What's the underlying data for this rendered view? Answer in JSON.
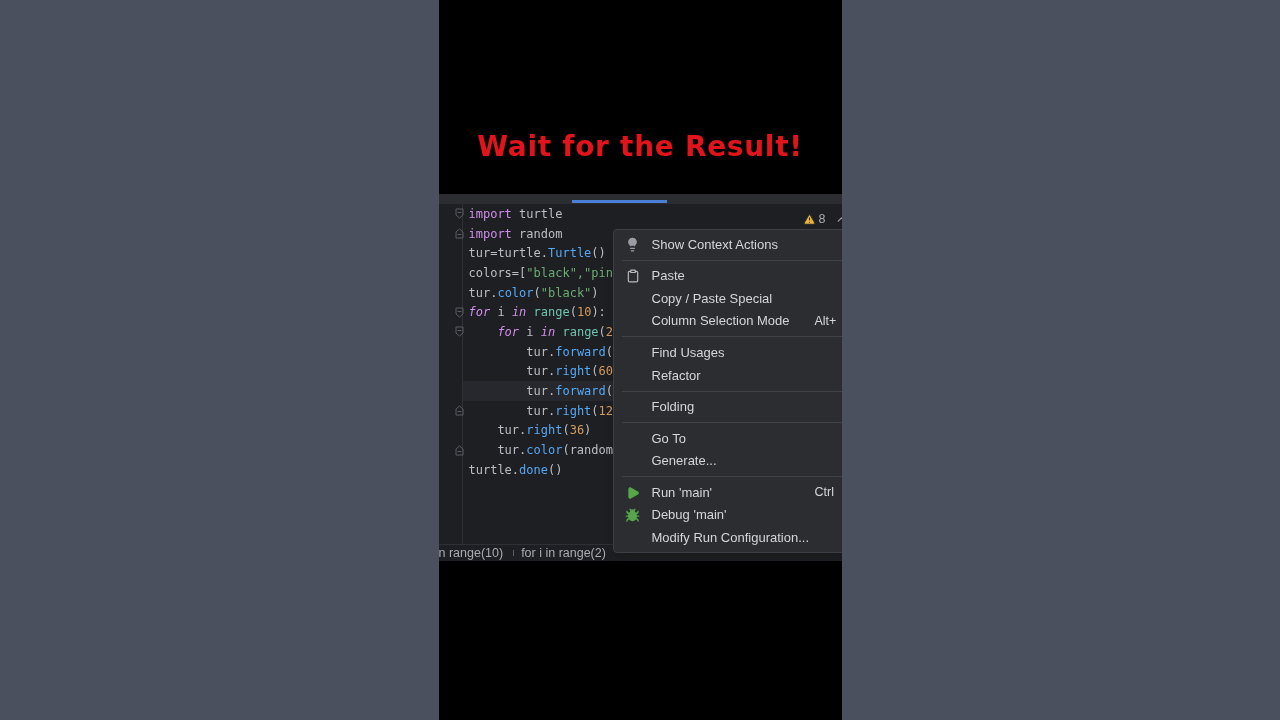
{
  "banner": {
    "title": "Wait for the Result!"
  },
  "editor": {
    "inspection": {
      "count": "8"
    },
    "lines": [
      {
        "kind": "fold-start",
        "current": false,
        "tokens": [
          {
            "kind": "keyword",
            "text": "import"
          },
          {
            "kind": "plain",
            "text": " turtle"
          }
        ]
      },
      {
        "kind": "fold-end",
        "current": false,
        "tokens": [
          {
            "kind": "keyword",
            "text": "import"
          },
          {
            "kind": "plain",
            "text": " random"
          }
        ]
      },
      {
        "current": false,
        "tokens": [
          {
            "kind": "plain",
            "text": "tur=turtle."
          },
          {
            "kind": "func",
            "text": "Turtle"
          },
          {
            "kind": "plain",
            "text": "()"
          }
        ]
      },
      {
        "current": false,
        "tokens": [
          {
            "kind": "plain",
            "text": "colors=["
          },
          {
            "kind": "string",
            "text": "\"black\",\"pin"
          }
        ]
      },
      {
        "current": false,
        "tokens": [
          {
            "kind": "plain",
            "text": "tur."
          },
          {
            "kind": "func",
            "text": "color"
          },
          {
            "kind": "plain",
            "text": "("
          },
          {
            "kind": "string",
            "text": "\"black\""
          },
          {
            "kind": "plain",
            "text": ")"
          }
        ]
      },
      {
        "kind": "fold-start",
        "current": false,
        "tokens": [
          {
            "kind": "italic",
            "text": "for"
          },
          {
            "kind": "plain",
            "text": " i "
          },
          {
            "kind": "italic",
            "text": "in "
          },
          {
            "kind": "builtin",
            "text": "range"
          },
          {
            "kind": "plain",
            "text": "("
          },
          {
            "kind": "number",
            "text": "10"
          },
          {
            "kind": "plain",
            "text": "):"
          }
        ]
      },
      {
        "kind": "fold-start",
        "current": false,
        "tokens": [
          {
            "kind": "italic",
            "text": "    for"
          },
          {
            "kind": "plain",
            "text": " i "
          },
          {
            "kind": "italic",
            "text": "in "
          },
          {
            "kind": "builtin",
            "text": "range"
          },
          {
            "kind": "plain",
            "text": "("
          },
          {
            "kind": "number",
            "text": "2"
          }
        ]
      },
      {
        "current": false,
        "tokens": [
          {
            "kind": "plain",
            "text": "        tur."
          },
          {
            "kind": "func",
            "text": "forward"
          },
          {
            "kind": "plain",
            "text": "("
          }
        ]
      },
      {
        "current": false,
        "tokens": [
          {
            "kind": "plain",
            "text": "        tur."
          },
          {
            "kind": "func",
            "text": "right"
          },
          {
            "kind": "plain",
            "text": "("
          },
          {
            "kind": "number",
            "text": "60"
          }
        ]
      },
      {
        "current": true,
        "tokens": [
          {
            "kind": "plain",
            "text": "        tur."
          },
          {
            "kind": "func",
            "text": "forward"
          },
          {
            "kind": "plain",
            "text": "("
          }
        ]
      },
      {
        "kind": "fold-end",
        "current": false,
        "tokens": [
          {
            "kind": "plain",
            "text": "        tur."
          },
          {
            "kind": "func",
            "text": "right"
          },
          {
            "kind": "plain",
            "text": "("
          },
          {
            "kind": "number",
            "text": "12"
          }
        ]
      },
      {
        "current": false,
        "tokens": [
          {
            "kind": "plain",
            "text": "    tur."
          },
          {
            "kind": "func",
            "text": "right"
          },
          {
            "kind": "plain",
            "text": "("
          },
          {
            "kind": "number",
            "text": "36"
          },
          {
            "kind": "plain",
            "text": ")"
          }
        ]
      },
      {
        "kind": "fold-end",
        "current": false,
        "tokens": [
          {
            "kind": "plain",
            "text": "    tur."
          },
          {
            "kind": "func",
            "text": "color"
          },
          {
            "kind": "plain",
            "text": "(random"
          }
        ]
      },
      {
        "current": false,
        "tokens": [
          {
            "kind": "plain",
            "text": "turtle."
          },
          {
            "kind": "func",
            "text": "done"
          },
          {
            "kind": "plain",
            "text": "()"
          }
        ]
      }
    ],
    "breadcrumbs": [
      "n range(10)",
      "for i in range(2)"
    ]
  },
  "context_menu": {
    "groups": [
      [
        {
          "kind": "bulb",
          "label": "Show Context Actions"
        }
      ],
      [
        {
          "kind": "paste",
          "label": "Paste"
        },
        {
          "kind": "plain",
          "label": "Copy / Paste Special"
        },
        {
          "kind": "plain",
          "label": "Column Selection Mode",
          "shortcut": "Alt+"
        }
      ],
      [
        {
          "kind": "plain",
          "label": "Find Usages"
        },
        {
          "kind": "plain",
          "label": "Refactor"
        }
      ],
      [
        {
          "kind": "plain",
          "label": "Folding"
        }
      ],
      [
        {
          "kind": "plain",
          "label": "Go To"
        },
        {
          "kind": "plain",
          "label": "Generate..."
        }
      ],
      [
        {
          "kind": "run",
          "label": "Run 'main'",
          "shortcut": "Ctrl"
        },
        {
          "kind": "debug",
          "label": "Debug 'main'"
        },
        {
          "kind": "plain",
          "label": "Modify Run Configuration..."
        }
      ]
    ]
  }
}
